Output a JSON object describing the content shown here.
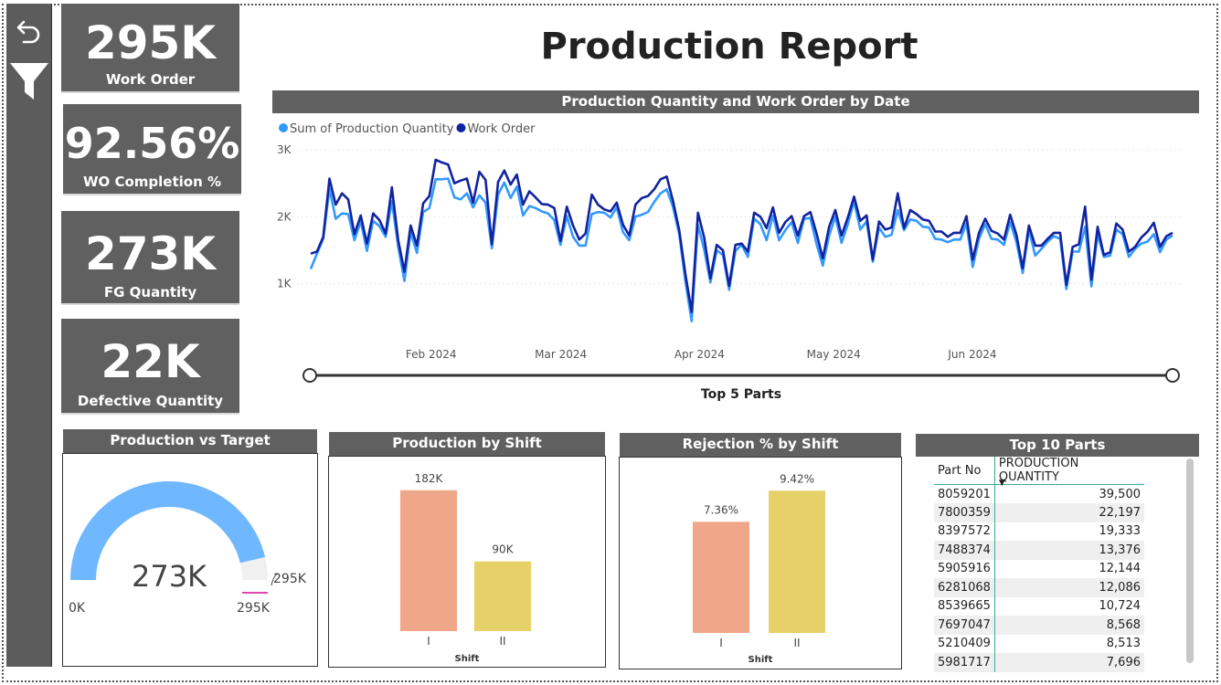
{
  "report_title": "Production Report",
  "sidebar": {
    "back_icon": "undo-arrow-icon",
    "filter_icon": "funnel-filter-icon"
  },
  "kpis": [
    {
      "value": "295K",
      "label": "Work Order"
    },
    {
      "value": "92.56%",
      "label": "WO Completion %"
    },
    {
      "value": "273K",
      "label": "FG Quantity"
    },
    {
      "value": "22K",
      "label": "Defective Quantity"
    }
  ],
  "colors": {
    "kpi_bg": "#606060",
    "series1": "#3399ff",
    "series2": "#12239e",
    "gauge_fill": "#6fb7ff",
    "gauge_rest": "#f0f0f0",
    "target_marker": "#e046ae",
    "bar_shift1": "#f0a688",
    "bar_shift2": "#e6d068"
  },
  "line_chart": {
    "header": "Production Quantity and Work Order by Date",
    "slicer_caption": "Top 5 Parts",
    "chart_data": {
      "type": "line",
      "series": [
        {
          "name": "Sum of Production Quantity",
          "color": "#3399ff",
          "values": [
            1220,
            1450,
            1670,
            2420,
            1970,
            2050,
            2040,
            1650,
            1930,
            1490,
            1940,
            1860,
            1700,
            2230,
            1550,
            1040,
            1770,
            1460,
            2070,
            2130,
            2560,
            2560,
            2570,
            2290,
            2260,
            2350,
            2140,
            2320,
            2210,
            1530,
            2330,
            2510,
            2280,
            2450,
            2020,
            2160,
            2130,
            2080,
            2050,
            1950,
            1580,
            2010,
            1700,
            1570,
            1570,
            2040,
            2070,
            2060,
            1990,
            2140,
            1770,
            1650,
            2000,
            2030,
            2070,
            2220,
            2350,
            2410,
            2150,
            1740,
            1030,
            440,
            1880,
            1510,
            1020,
            1500,
            1430,
            910,
            1490,
            1580,
            1400,
            1970,
            1890,
            1650,
            2020,
            1650,
            1800,
            1920,
            1610,
            1970,
            1980,
            1590,
            1270,
            1720,
            2000,
            1610,
            1890,
            2230,
            1810,
            1930,
            1330,
            1840,
            1700,
            1730,
            2100,
            1800,
            1960,
            1940,
            1850,
            1840,
            1670,
            1660,
            1620,
            1660,
            1660,
            1900,
            1250,
            1670,
            1890,
            1670,
            1660,
            1580,
            1920,
            1620,
            1160,
            1810,
            1420,
            1520,
            1630,
            1710,
            1670,
            920,
            1480,
            1480,
            1850,
            960,
            1740,
            1400,
            1420,
            1810,
            1740,
            1400,
            1520,
            1600,
            1630,
            1740,
            1470,
            1660,
            1720
          ]
        },
        {
          "name": "Work Order",
          "color": "#12239e",
          "values": [
            1450,
            1480,
            1700,
            2570,
            2180,
            2350,
            2260,
            1740,
            2020,
            1600,
            2050,
            1950,
            1750,
            2440,
            1650,
            1180,
            1870,
            1570,
            2200,
            2310,
            2850,
            2810,
            2780,
            2500,
            2540,
            2570,
            2210,
            2670,
            2550,
            1590,
            2520,
            2690,
            2480,
            2630,
            2180,
            2380,
            2290,
            2190,
            2180,
            2130,
            1640,
            2150,
            1870,
            1660,
            1750,
            2330,
            2180,
            2110,
            2080,
            2210,
            1880,
            1720,
            2180,
            2280,
            2310,
            2410,
            2560,
            2600,
            2240,
            1800,
            1140,
            580,
            2060,
            1690,
            1080,
            1580,
            1500,
            970,
            1580,
            1600,
            1480,
            2060,
            2000,
            1830,
            2140,
            1760,
            1920,
            2010,
            1720,
            2010,
            2070,
            1750,
            1380,
            1850,
            2100,
            1720,
            1990,
            2300,
            1940,
            2020,
            1360,
            1930,
            1810,
            1840,
            2350,
            1830,
            2100,
            2040,
            1960,
            1940,
            1780,
            1780,
            1700,
            1760,
            1760,
            2010,
            1360,
            1760,
            1970,
            1790,
            1750,
            1660,
            2030,
            1730,
            1230,
            1870,
            1570,
            1570,
            1670,
            1760,
            1760,
            980,
            1550,
            1590,
            2150,
            1060,
            1850,
            1430,
            1470,
            1900,
            1810,
            1480,
            1550,
            1690,
            1780,
            1910,
            1550,
            1710,
            1760
          ]
        }
      ],
      "x_start": "2024-01-01",
      "x_end": "2024-07-18",
      "x_tick_labels": [
        "Feb 2024",
        "Mar 2024",
        "Apr 2024",
        "May 2024",
        "Jun 2024"
      ],
      "y_tick_labels": [
        "1K",
        "2K",
        "3K"
      ],
      "ylim": [
        0,
        3000
      ],
      "legend_position": "top-left",
      "grid": true
    }
  },
  "gauge": {
    "header": "Production vs Target",
    "value_label": "273K",
    "min_label": "0K",
    "max_label": "295K",
    "target_label": "295K",
    "value": 273,
    "max": 295
  },
  "shift_chart": {
    "header": "Production by Shift",
    "chart_data": {
      "type": "bar",
      "categories": [
        "I",
        "II"
      ],
      "values": [
        182,
        90
      ],
      "data_labels": [
        "182K",
        "90K"
      ],
      "xlabel": "Shift",
      "ylim": [
        0,
        190
      ]
    }
  },
  "rejection_chart": {
    "header": "Rejection % by Shift",
    "chart_data": {
      "type": "bar",
      "categories": [
        "I",
        "II"
      ],
      "values": [
        7.36,
        9.42
      ],
      "data_labels": [
        "7.36%",
        "9.42%"
      ],
      "xlabel": "Shift",
      "ylim": [
        0,
        9.8
      ]
    }
  },
  "top_parts": {
    "header": "Top 10 Parts",
    "columns": [
      "Part No",
      "PRODUCTION QUANTITY"
    ],
    "rows": [
      [
        "8059201",
        "39,500"
      ],
      [
        "7800359",
        "22,197"
      ],
      [
        "8397572",
        "19,333"
      ],
      [
        "7488374",
        "13,376"
      ],
      [
        "5905916",
        "12,144"
      ],
      [
        "6281068",
        "12,086"
      ],
      [
        "8539665",
        "10,724"
      ],
      [
        "7697047",
        "8,568"
      ],
      [
        "5210409",
        "8,513"
      ],
      [
        "5981717",
        "7,696"
      ]
    ]
  }
}
